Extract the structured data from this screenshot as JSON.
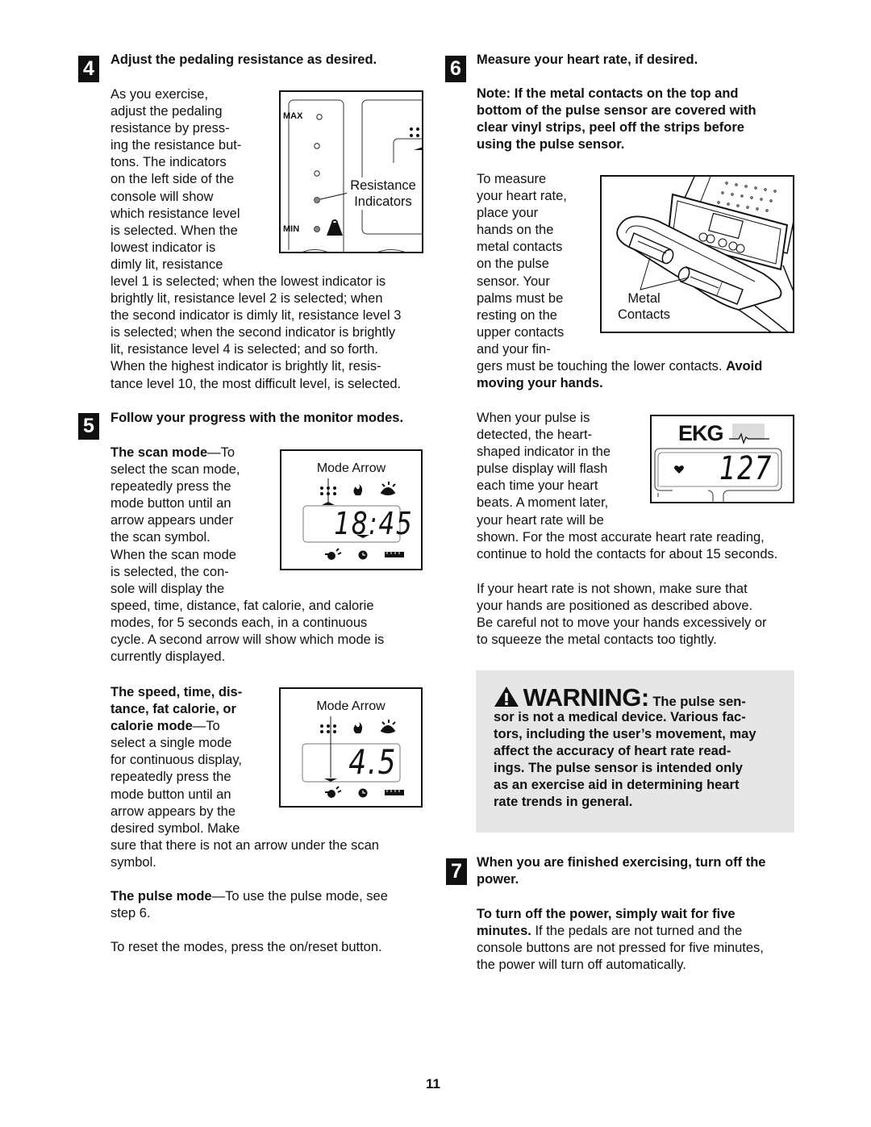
{
  "page_number": "11",
  "colors": {
    "text": "#111111",
    "warning_bg": "#e6e6e6",
    "lcd_led_dim": "#888888"
  },
  "step4": {
    "number": "4",
    "title": "Adjust the pedaling resistance as desired.",
    "wrap_lines": [
      "As you exercise,",
      "adjust the pedaling",
      "resistance by press-",
      "ing the resistance but-",
      "tons. The indicators",
      "on the left side of the",
      "console will show",
      "which resistance level",
      "is selected. When the",
      "lowest indicator is",
      "dimly lit, resistance"
    ],
    "full_lines": [
      "level 1 is selected; when the lowest indicator is",
      "brightly lit, resistance level 2 is selected; when",
      "the second indicator is dimly lit, resistance level 3",
      "is selected; when the second indicator is brightly",
      "lit, resistance level 4 is selected; and so forth.",
      "When the highest indicator is brightly lit, resis-",
      "tance level 10, the most difficult level, is selected."
    ],
    "figure": {
      "max_label": "MAX",
      "min_label": "MIN",
      "callout_line1": "Resistance",
      "callout_line2": "Indicators"
    }
  },
  "step5": {
    "number": "5",
    "title": "Follow your progress with the monitor modes.",
    "scan": {
      "heading": "The scan mode",
      "wrap_lines": [
        "—To",
        "select the scan mode,",
        "repeatedly press the",
        "mode button until an",
        "arrow appears under",
        "the scan symbol.",
        "When the scan mode",
        "is selected, the con-",
        "sole will display the"
      ],
      "full_lines": [
        "speed, time, distance, fat calorie, and calorie",
        "modes, for 5 seconds each, in a continuous",
        "cycle. A second arrow will show which mode is",
        "currently displayed."
      ],
      "figure": {
        "label": "Mode Arrow",
        "display": "18:45"
      }
    },
    "single": {
      "heading_lines": [
        "The speed, time, dis-",
        "tance, fat calorie, or",
        "calorie mode"
      ],
      "wrap_lines": [
        "—To",
        "select a single mode",
        "for continuous display,",
        "repeatedly press the",
        "mode button until an",
        "arrow appears by the",
        "desired symbol. Make"
      ],
      "full_lines": [
        "sure that there is not an arrow under the scan",
        "symbol."
      ],
      "figure": {
        "label": "Mode Arrow",
        "display": "4.5"
      }
    },
    "pulse": {
      "heading": "The pulse mode",
      "text_line1": "—To use the pulse mode, see",
      "text_line2": "step 6."
    },
    "reset": "To reset the modes, press the on/reset button."
  },
  "step6": {
    "number": "6",
    "title": "Measure your heart rate, if desired.",
    "note_lines": [
      "Note: If the metal contacts on the top and",
      "bottom of the pulse sensor are covered with",
      "clear vinyl strips, peel off the strips before",
      "using the pulse sensor."
    ],
    "measure_wrap": [
      "To measure",
      "your heart rate,",
      "place your",
      "hands on the",
      "metal contacts",
      "on the pulse",
      "sensor. Your",
      "palms must be",
      "resting on the",
      "upper contacts",
      "and your fin-"
    ],
    "measure_full_plain": "gers must be touching the lower contacts. ",
    "measure_full_bold1": "Avoid",
    "measure_full_bold2": "moving your hands.",
    "contacts_figure": {
      "label_line1": "Metal",
      "label_line2": "Contacts"
    },
    "pulse_wrap": [
      "When your pulse is",
      "detected, the heart-",
      "shaped indicator in the",
      "pulse display will flash",
      "each time your heart",
      "beats. A moment later,",
      "your heart rate will be"
    ],
    "pulse_full": [
      "shown. For the most accurate heart rate reading,",
      "continue to hold the contacts for about 15 seconds."
    ],
    "ekg_figure": {
      "brand": "EKG",
      "heart_rate": "127"
    },
    "not_shown_lines": [
      "If your heart rate is not shown, make sure that",
      "your hands are positioned as described above.",
      "Be careful not to move your hands excessively or",
      "to squeeze the metal contacts too tightly."
    ],
    "warning": {
      "label": "WARNING:",
      "first_line_rest": "The pulse sen-",
      "lines": [
        "sor is not a medical device. Various fac-",
        "tors, including the user’s movement, may",
        "affect the accuracy of heart rate read-",
        "ings. The pulse sensor is intended only",
        "as an exercise aid in determining heart",
        "rate trends in general."
      ]
    }
  },
  "step7": {
    "number": "7",
    "title_line1": "When you are finished exercising, turn off the",
    "title_line2": "power.",
    "bold_line1": "To turn off the power, simply wait for five",
    "bold_line2": "minutes.",
    "line2_rest": " If the pedals are not turned and the",
    "lines": [
      "console buttons are not pressed for five minutes,",
      "the power will turn off automatically."
    ]
  }
}
